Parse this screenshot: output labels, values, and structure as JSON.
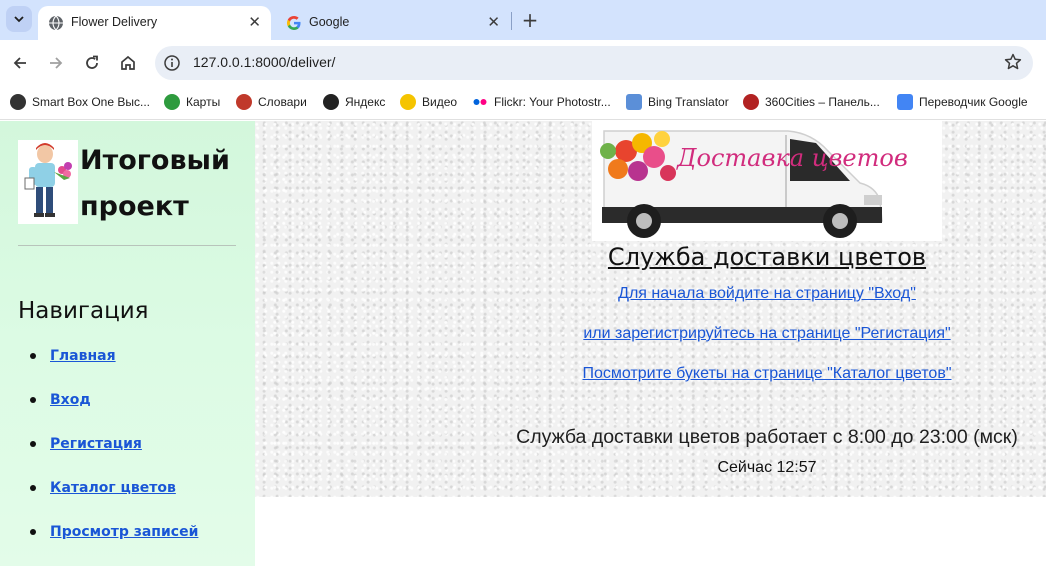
{
  "browser": {
    "tabs": [
      {
        "title": "Flower Delivery",
        "active": true,
        "icon": "globe-icon"
      },
      {
        "title": "Google",
        "active": false,
        "icon": "google-icon"
      }
    ],
    "url": "127.0.0.1:8000/deliver/",
    "bookmarks": [
      {
        "label": "Smart Box One Выс...",
        "icon": "smartbox-icon",
        "color": "#333333"
      },
      {
        "label": "Карты",
        "icon": "maps-icon",
        "color": "#2e9b3e"
      },
      {
        "label": "Словари",
        "icon": "dictionary-icon",
        "color": "#c0392b"
      },
      {
        "label": "Яндекс",
        "icon": "yandex-icon",
        "color": "#222222"
      },
      {
        "label": "Видео",
        "icon": "video-icon",
        "color": "#f5c400"
      },
      {
        "label": "Flickr: Your Photostr...",
        "icon": "flickr-icon",
        "color": "#ff0084"
      },
      {
        "label": "Bing Translator",
        "icon": "bing-translator-icon",
        "color": "#5b8fd8"
      },
      {
        "label": "360Cities – Панель...",
        "icon": "360cities-icon",
        "color": "#b22222"
      },
      {
        "label": "Переводчик Google",
        "icon": "google-translate-icon",
        "color": "#4285f4"
      }
    ]
  },
  "sidebar": {
    "title": "Итоговый проект",
    "nav_heading": "Навигация",
    "nav_items": [
      {
        "label": "Главная"
      },
      {
        "label": "Вход"
      },
      {
        "label": "Регистация"
      },
      {
        "label": "Каталог цветов"
      },
      {
        "label": "Просмотр записей"
      }
    ]
  },
  "main": {
    "van_sign": "Доставка цветов",
    "title": "Служба доставки цветов",
    "links": [
      "Для начала войдите на страницу \"Вход\"",
      "или зарегистрируйтесь на странице \"Регистация\"",
      "Посмотрите букеты на странице \"Каталог цветов\""
    ],
    "hours": "Служба доставки цветов работает с 8:00 до 23:00 (мск)",
    "now": "Сейчас 12:57"
  },
  "colors": {
    "link": "#1a56d6",
    "sidebar_bg": "#d9f9e1",
    "tabstrip_bg": "#d3e3fd"
  }
}
